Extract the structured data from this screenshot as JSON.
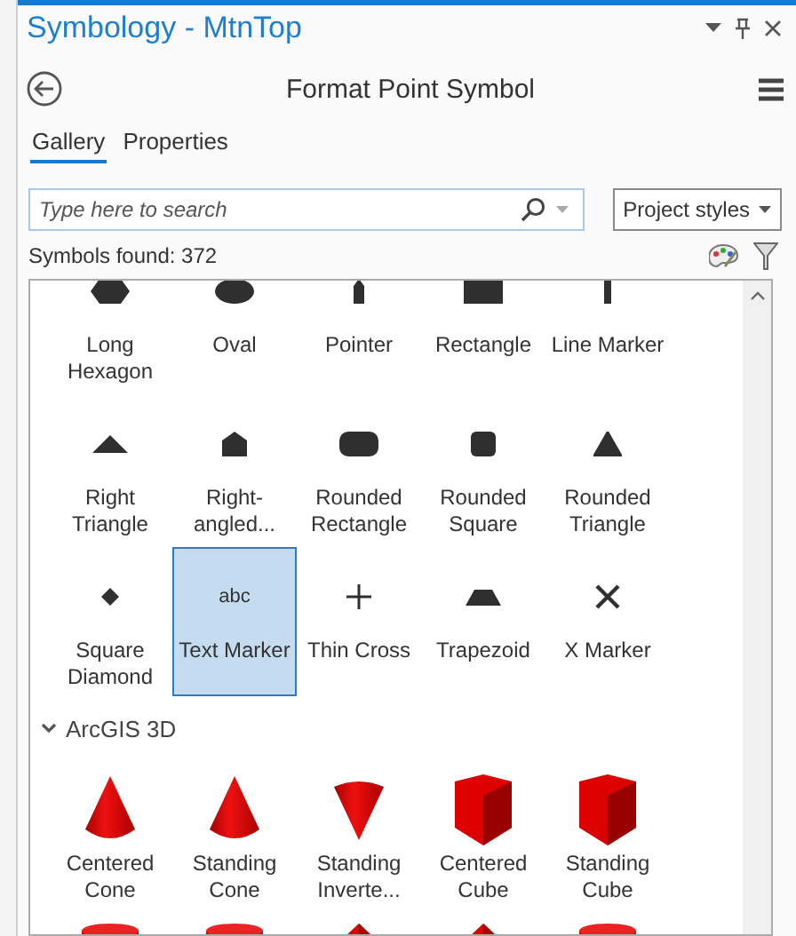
{
  "panel": {
    "title": "Symbology - MtnTop",
    "heading": "Format Point Symbol"
  },
  "tabs": [
    {
      "label": "Gallery",
      "selected": true
    },
    {
      "label": "Properties",
      "selected": false
    }
  ],
  "search": {
    "placeholder": "Type here to search"
  },
  "style_dropdown": {
    "value": "Project styles"
  },
  "symbols_found": "Symbols found: 372",
  "groups": [
    {
      "symbols": [
        {
          "label": "Long Hexagon",
          "kind": "hexagon",
          "selected": false
        },
        {
          "label": "Oval",
          "kind": "oval",
          "selected": false
        },
        {
          "label": "Pointer",
          "kind": "pointer",
          "selected": false
        },
        {
          "label": "Rectangle",
          "kind": "rectangle",
          "selected": false
        },
        {
          "label": "Line Marker",
          "kind": "line",
          "selected": false
        },
        {
          "label": "Right Triangle",
          "kind": "flat-triangle",
          "selected": false
        },
        {
          "label": "Right-angled...",
          "kind": "house",
          "selected": false
        },
        {
          "label": "Rounded Rectangle",
          "kind": "rounded-rectangle",
          "selected": false
        },
        {
          "label": "Rounded Square",
          "kind": "rounded-square",
          "selected": false
        },
        {
          "label": "Rounded Triangle",
          "kind": "triangle",
          "selected": false
        },
        {
          "label": "Square Diamond",
          "kind": "diamond",
          "selected": false
        },
        {
          "label": "Text Marker",
          "kind": "text",
          "glyph": "abc",
          "selected": true
        },
        {
          "label": "Thin Cross",
          "kind": "cross",
          "selected": false
        },
        {
          "label": "Trapezoid",
          "kind": "trapezoid",
          "selected": false
        },
        {
          "label": "X Marker",
          "kind": "x",
          "selected": false
        }
      ]
    },
    {
      "name": "ArcGIS 3D",
      "expanded": true,
      "symbols": [
        {
          "label": "Centered Cone",
          "kind": "cone",
          "selected": false
        },
        {
          "label": "Standing Cone",
          "kind": "cone",
          "selected": false
        },
        {
          "label": "Standing Inverte...",
          "kind": "inverted-cone",
          "selected": false
        },
        {
          "label": "Centered Cube",
          "kind": "cube",
          "selected": false
        },
        {
          "label": "Standing Cube",
          "kind": "cube",
          "selected": false
        },
        {
          "kind": "cylinder",
          "selected": false
        },
        {
          "kind": "cylinder",
          "selected": false
        },
        {
          "kind": "pyramid",
          "selected": false
        },
        {
          "kind": "pyramid",
          "selected": false
        },
        {
          "kind": "cylinder",
          "selected": false
        }
      ]
    }
  ]
}
